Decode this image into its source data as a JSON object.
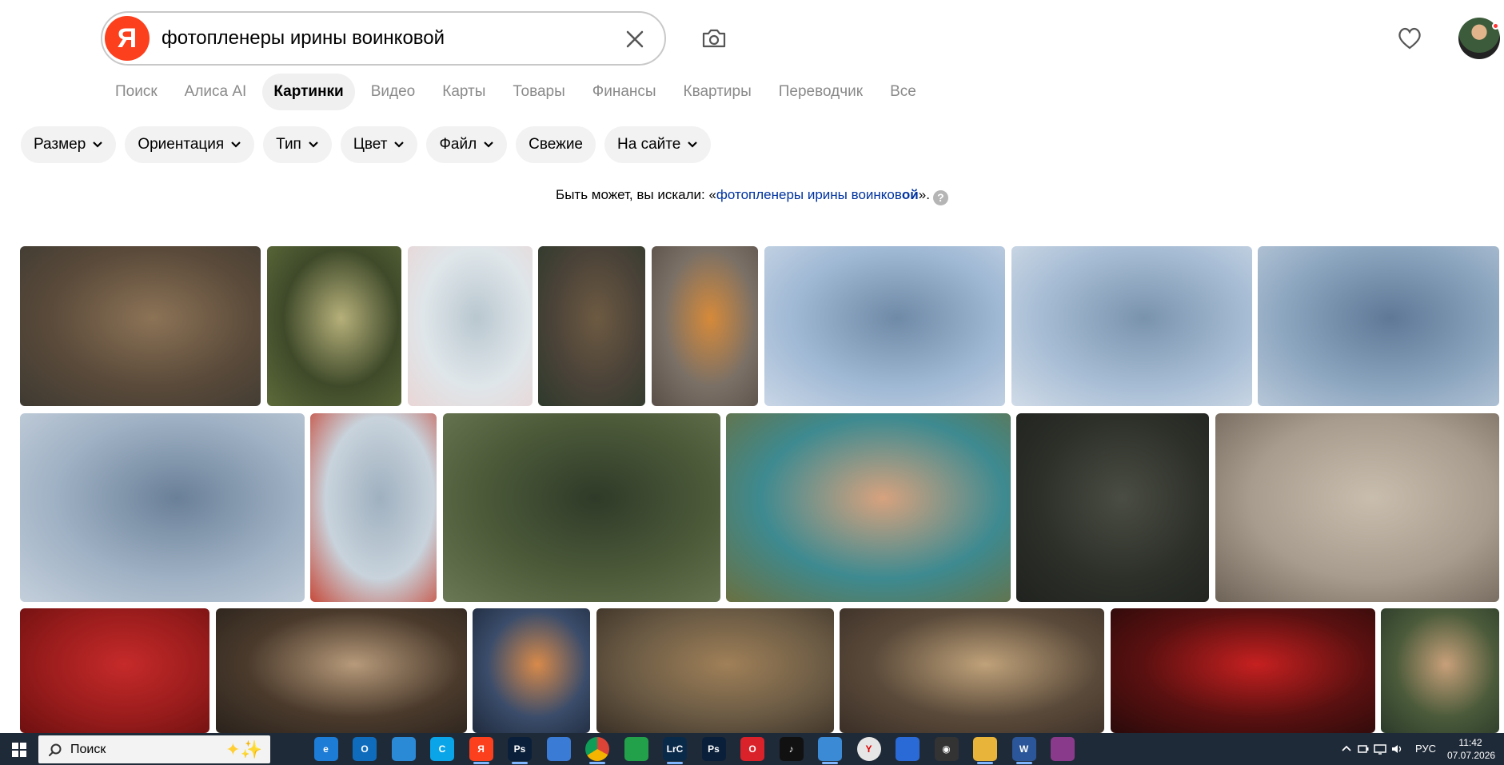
{
  "header": {
    "logo_letter": "Я",
    "search_query": "фотопленеры ирины воинковой"
  },
  "nav_tabs": [
    {
      "label": "Поиск",
      "active": false
    },
    {
      "label": "Алиса AI",
      "active": false
    },
    {
      "label": "Картинки",
      "active": true
    },
    {
      "label": "Видео",
      "active": false
    },
    {
      "label": "Карты",
      "active": false
    },
    {
      "label": "Товары",
      "active": false
    },
    {
      "label": "Финансы",
      "active": false
    },
    {
      "label": "Квартиры",
      "active": false
    },
    {
      "label": "Переводчик",
      "active": false
    },
    {
      "label": "Все",
      "active": false
    }
  ],
  "filters": [
    {
      "label": "Размер",
      "dropdown": true
    },
    {
      "label": "Ориентация",
      "dropdown": true
    },
    {
      "label": "Тип",
      "dropdown": true
    },
    {
      "label": "Цвет",
      "dropdown": true
    },
    {
      "label": "Файл",
      "dropdown": true
    },
    {
      "label": "Свежие",
      "dropdown": false
    },
    {
      "label": "На сайте",
      "dropdown": true
    }
  ],
  "suggestion": {
    "prefix": "Быть может, вы искали: «",
    "link_plain": "фотопленеры ирины воинков",
    "link_bold": "ой",
    "suffix": "».",
    "help": "?"
  },
  "images": [
    {
      "name": "hooded-woman-forest",
      "colors": [
        "#5a4a3a",
        "#8c7356",
        "#3e3a32"
      ]
    },
    {
      "name": "girl-in-forest-white-dress",
      "colors": [
        "#3f4a2a",
        "#b6b07a",
        "#5d6b3a"
      ]
    },
    {
      "name": "flower-with-ladybug",
      "colors": [
        "#dfe6ea",
        "#b9c7cf",
        "#e9d6d6"
      ]
    },
    {
      "name": "woman-by-stone-wall",
      "colors": [
        "#4a4238",
        "#6d5a42",
        "#2e3a2c"
      ]
    },
    {
      "name": "redhead-with-camera",
      "colors": [
        "#7a7066",
        "#d68a3a",
        "#5a4f48"
      ]
    },
    {
      "name": "two-mermaids-on-rock",
      "colors": [
        "#9fb8d4",
        "#6f8aa6",
        "#c9d6e6"
      ]
    },
    {
      "name": "two-mermaids-lake",
      "colors": [
        "#a6bcd4",
        "#7a93ad",
        "#d0dbe7"
      ]
    },
    {
      "name": "mermaid-lying-on-rock",
      "colors": [
        "#8aa4be",
        "#5e7896",
        "#b7c7d8"
      ]
    },
    {
      "name": "mermaids-on-shore",
      "colors": [
        "#9fb1c4",
        "#6a8098",
        "#c4cfdb"
      ]
    },
    {
      "name": "bullfinch-on-branch",
      "colors": [
        "#c8d3dc",
        "#9fb0bf",
        "#c74a3a"
      ]
    },
    {
      "name": "woman-with-black-wings",
      "colors": [
        "#4d5b3a",
        "#2f3a28",
        "#6b7855"
      ]
    },
    {
      "name": "baroque-costume-trio",
      "colors": [
        "#3d8a90",
        "#d7a27e",
        "#6a7040"
      ]
    },
    {
      "name": "dancer-dark-ruins",
      "colors": [
        "#2d3029",
        "#4a4d43",
        "#1f221e"
      ]
    },
    {
      "name": "woman-with-tambourine",
      "colors": [
        "#a89c8e",
        "#c9beae",
        "#6e6357"
      ]
    },
    {
      "name": "dancer-red-background",
      "colors": [
        "#9a1c1c",
        "#c62a2a",
        "#6e1010"
      ]
    },
    {
      "name": "costumed-group-stage",
      "colors": [
        "#4a3a2c",
        "#b79a7a",
        "#2a221c"
      ]
    },
    {
      "name": "woman-in-tunnel",
      "colors": [
        "#3a4c6a",
        "#d88a4a",
        "#1f2a3d"
      ]
    },
    {
      "name": "couple-in-hats-forest",
      "colors": [
        "#6a5a44",
        "#a08058",
        "#3a3026"
      ]
    },
    {
      "name": "blonde-woman-portrait",
      "colors": [
        "#5a4a3a",
        "#c0a27a",
        "#3a2e26"
      ]
    },
    {
      "name": "clown-mask-red",
      "colors": [
        "#5a1010",
        "#c62020",
        "#2a0a0a"
      ]
    },
    {
      "name": "smiling-woman-green-dress",
      "colors": [
        "#4a5a3a",
        "#c8a07a",
        "#2a3a2a"
      ]
    }
  ],
  "taskbar": {
    "search_label": "Поиск",
    "lang": "РУС",
    "time": "11:42",
    "date": "07.07.2026",
    "apps": [
      {
        "name": "task-view",
        "label": "",
        "color": "#1f2a38"
      },
      {
        "name": "edge",
        "label": "e",
        "color": "#1c7cd6"
      },
      {
        "name": "outlook",
        "label": "O",
        "color": "#0f6cbd"
      },
      {
        "name": "file-transfer",
        "label": "",
        "color": "#2a8ad6"
      },
      {
        "name": "c-app",
        "label": "C",
        "color": "#0aa4e8"
      },
      {
        "name": "yandex",
        "label": "Я",
        "color": "#fc3f1d"
      },
      {
        "name": "photoshop",
        "label": "Ps",
        "color": "#0a1f3a"
      },
      {
        "name": "camera-app",
        "label": "",
        "color": "#3a7bd5"
      },
      {
        "name": "chrome",
        "label": "",
        "color": "#1f2a38"
      },
      {
        "name": "green-app",
        "label": "",
        "color": "#22a04a"
      },
      {
        "name": "lightroom",
        "label": "LrC",
        "color": "#0a2a4a"
      },
      {
        "name": "photoshop-2",
        "label": "Ps",
        "color": "#0a1f3a"
      },
      {
        "name": "opera",
        "label": "O",
        "color": "#d9222a"
      },
      {
        "name": "tiktok",
        "label": "♪",
        "color": "#111111"
      },
      {
        "name": "remote-app",
        "label": "",
        "color": "#3a8ad6"
      },
      {
        "name": "yandex-browser",
        "label": "Y",
        "color": "#e6e6e6"
      },
      {
        "name": "blue-app",
        "label": "",
        "color": "#2a6ad6"
      },
      {
        "name": "obs",
        "label": "◉",
        "color": "#333333"
      },
      {
        "name": "explorer",
        "label": "",
        "color": "#e8b43a"
      },
      {
        "name": "word",
        "label": "W",
        "color": "#2b579a"
      },
      {
        "name": "winrar",
        "label": "",
        "color": "#8a3a8a"
      }
    ]
  }
}
